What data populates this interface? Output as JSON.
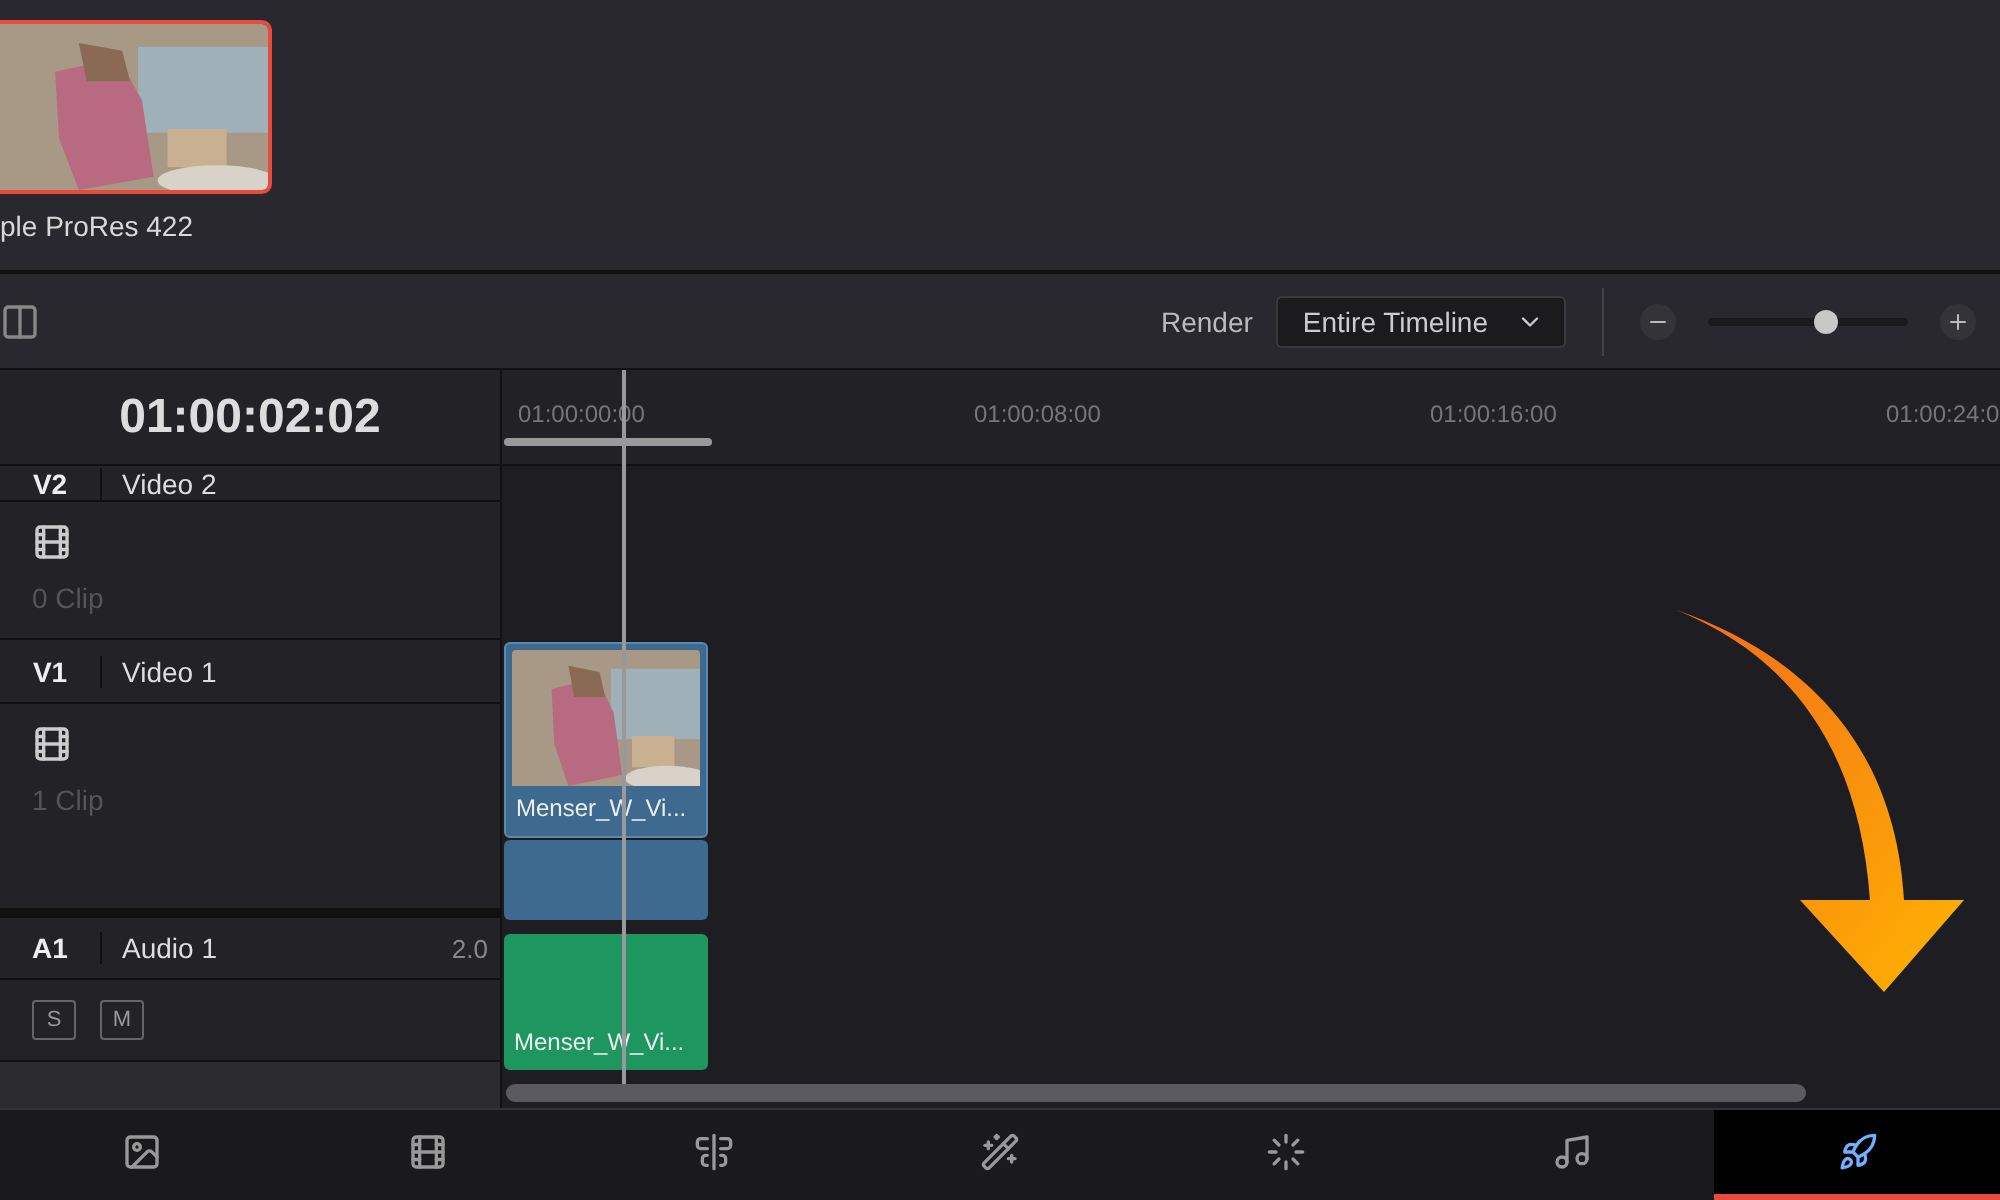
{
  "media_pool": {
    "clip": {
      "name": "ple ProRes 422",
      "selected": true
    }
  },
  "toolbar": {
    "render_label": "Render",
    "render_dropdown": "Entire Timeline",
    "zoom": {
      "level": 0.59
    }
  },
  "timeline": {
    "timecode": "01:00:02:02",
    "ruler": [
      "01:00:00:00",
      "01:00:08:00",
      "01:00:16:00",
      "01:00:24:0"
    ],
    "tracks": [
      {
        "kind": "video",
        "id_label": "V2",
        "name": "Video 2",
        "clip_count": "0 Clip"
      },
      {
        "kind": "video",
        "id_label": "V1",
        "name": "Video 1",
        "clip_count": "1 Clip"
      },
      {
        "kind": "audio",
        "id_label": "A1",
        "name": "Audio 1",
        "channels": "2.0",
        "solo_label": "S",
        "mute_label": "M"
      }
    ],
    "clips": [
      {
        "kind": "video",
        "name": "Menser_W_Vi..."
      },
      {
        "kind": "audio",
        "name": "Menser_W_Vi..."
      }
    ]
  },
  "page_nav": [
    {
      "kind": "media",
      "selected": false
    },
    {
      "kind": "cut",
      "selected": false
    },
    {
      "kind": "edit",
      "selected": false
    },
    {
      "kind": "fusion",
      "selected": false
    },
    {
      "kind": "color",
      "selected": false
    },
    {
      "kind": "fairlight",
      "selected": false
    },
    {
      "kind": "deliver",
      "selected": true
    }
  ]
}
